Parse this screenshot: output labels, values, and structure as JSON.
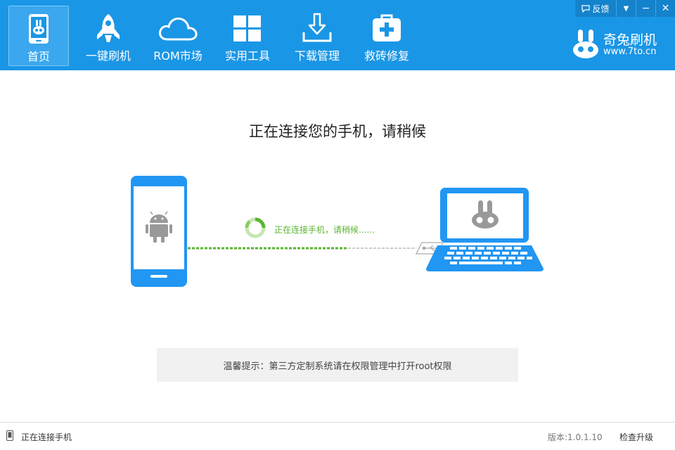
{
  "window": {
    "feedback_label": "反馈",
    "feedback_icon": "speech-bubble-icon",
    "dropdown_glyph": "▼",
    "minimize_glyph": "−",
    "close_glyph": "✕"
  },
  "nav": {
    "items": [
      {
        "label": "首页",
        "icon": "phone-rabbit-icon",
        "active": true
      },
      {
        "label": "一键刷机",
        "icon": "rocket-icon",
        "active": false
      },
      {
        "label": "ROM市场",
        "icon": "cloud-icon",
        "active": false
      },
      {
        "label": "实用工具",
        "icon": "windows-grid-icon",
        "active": false
      },
      {
        "label": "下载管理",
        "icon": "download-icon",
        "active": false
      },
      {
        "label": "救砖修复",
        "icon": "medical-kit-icon",
        "active": false
      }
    ]
  },
  "brand": {
    "name": "奇兔刷机",
    "url": "www.7to.cn"
  },
  "main": {
    "headline": "正在连接您的手机，请稍候",
    "connecting_text": "正在连接手机，请稍候......",
    "tip": "温馨提示：第三方定制系统请在权限管理中打开root权限"
  },
  "status_bar": {
    "status": "正在连接手机",
    "version": "版本:1.0.1.10",
    "upgrade": "检查升级"
  },
  "colors": {
    "primary": "#1a96e6",
    "progress_green": "#5ab531",
    "device_blue": "#2196f3"
  }
}
